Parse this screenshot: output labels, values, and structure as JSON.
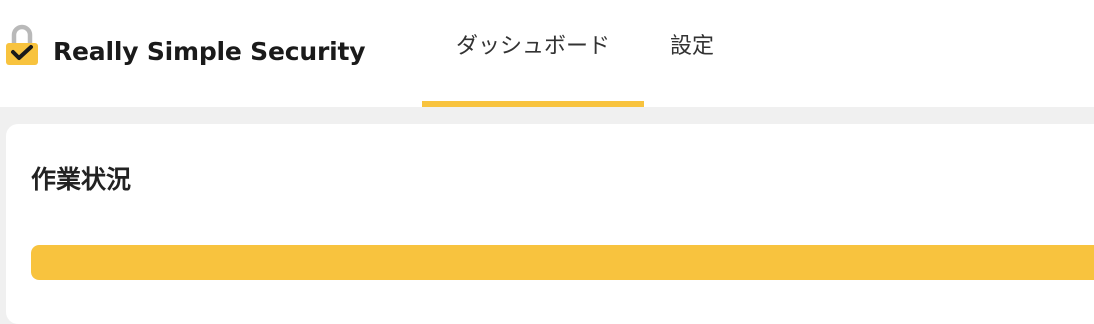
{
  "header": {
    "brand": "Really Simple Security",
    "tabs": [
      {
        "label": "ダッシュボード",
        "active": true
      },
      {
        "label": "設定",
        "active": false
      }
    ]
  },
  "main": {
    "card_title": "作業状況",
    "progress": 1.0
  },
  "colors": {
    "accent": "#f8c33e",
    "background": "#f0f0f0",
    "card": "#ffffff",
    "text": "#1a1a1a"
  },
  "icons": {
    "logo": "lock-check-icon"
  }
}
